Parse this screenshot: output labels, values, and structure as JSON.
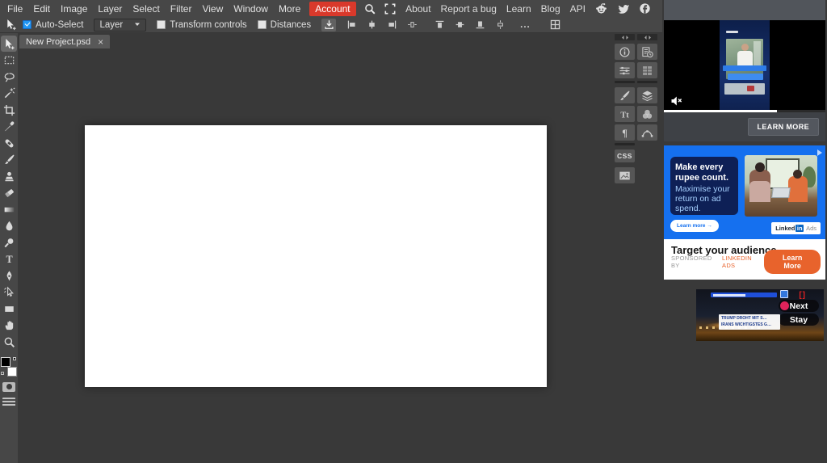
{
  "colors": {
    "account_red": "#d9392b",
    "checkbox_blue": "#2196f3",
    "linkedin_blue": "#1570ef",
    "linkedin_navy": "#0e2056",
    "linkedin_lightblue": "#a6d0ff",
    "linkedin_brand_blue": "#0a66c2",
    "cta_orange": "#e8632c"
  },
  "menubar": {
    "items": [
      "File",
      "Edit",
      "Image",
      "Layer",
      "Select",
      "Filter",
      "View",
      "Window",
      "More"
    ],
    "account_label": "Account",
    "links": [
      "About",
      "Report a bug",
      "Learn",
      "Blog",
      "API"
    ],
    "social_icons": [
      "reddit-icon",
      "twitter-icon",
      "facebook-icon"
    ]
  },
  "options": {
    "auto_select": "Auto-Select",
    "layer_select_value": "Layer",
    "transform_controls": "Transform controls",
    "distances": "Distances",
    "more": "...",
    "align_icons": [
      "align-left-icon",
      "align-center-h-icon",
      "align-right-icon",
      "distribute-h-icon"
    ],
    "align_icons2": [
      "align-top-icon",
      "align-middle-icon",
      "align-bottom-icon",
      "distribute-v-icon"
    ]
  },
  "tabs": [
    {
      "title": "New Project.psd",
      "close": "×"
    }
  ],
  "left_toolbar": {
    "tools": [
      "move-tool",
      "marquee-tool",
      "lasso-tool",
      "wand-tool",
      "crop-tool",
      "eyedropper-tool",
      "heal-tool",
      "brush-tool",
      "clone-tool",
      "eraser-tool",
      "gradient-tool",
      "blur-tool",
      "dodge-tool",
      "text-tool",
      "pen-tool",
      "path-select-tool",
      "shape-tool",
      "hand-tool",
      "zoom-tool"
    ],
    "selected_tool": "move-tool",
    "foreground_color": "#000000",
    "background_color": "#ffffff"
  },
  "right_panels": {
    "col1_groups": [
      [
        "info-icon",
        "adjust-icon"
      ],
      [
        "brush-icon",
        "character-icon",
        "paragraph-icon"
      ],
      [
        "css-button",
        "image-icon"
      ]
    ],
    "col2_groups": [
      [
        "history-icon",
        "panel-grid-icon"
      ],
      [
        "layers-icon",
        "swatches-icon",
        "curve-icon"
      ]
    ],
    "css_label": "CSS"
  },
  "ads": {
    "video_ad": {
      "cta": "LEARN MORE",
      "progress_percent": 70
    },
    "linkedin_ad": {
      "headline": "Make every rupee count.",
      "subheadline": "Maximise your return on ad spend.",
      "cta_pill": "Learn more →",
      "logo_linked": "Linked",
      "logo_in": "in",
      "logo_ads": "Ads",
      "tagline": "Target your audience.",
      "sponsored_by": "SPONSORED BY",
      "sponsor_name": "LINKEDIN ADS",
      "cta_button": "Learn More"
    },
    "news_ad": {
      "next_label": "Next",
      "stay_label": "Stay",
      "caption_line1": "TRUMP DROHT MIT S…",
      "caption_line2": "IRANS WICHTIGSTES G…"
    }
  }
}
